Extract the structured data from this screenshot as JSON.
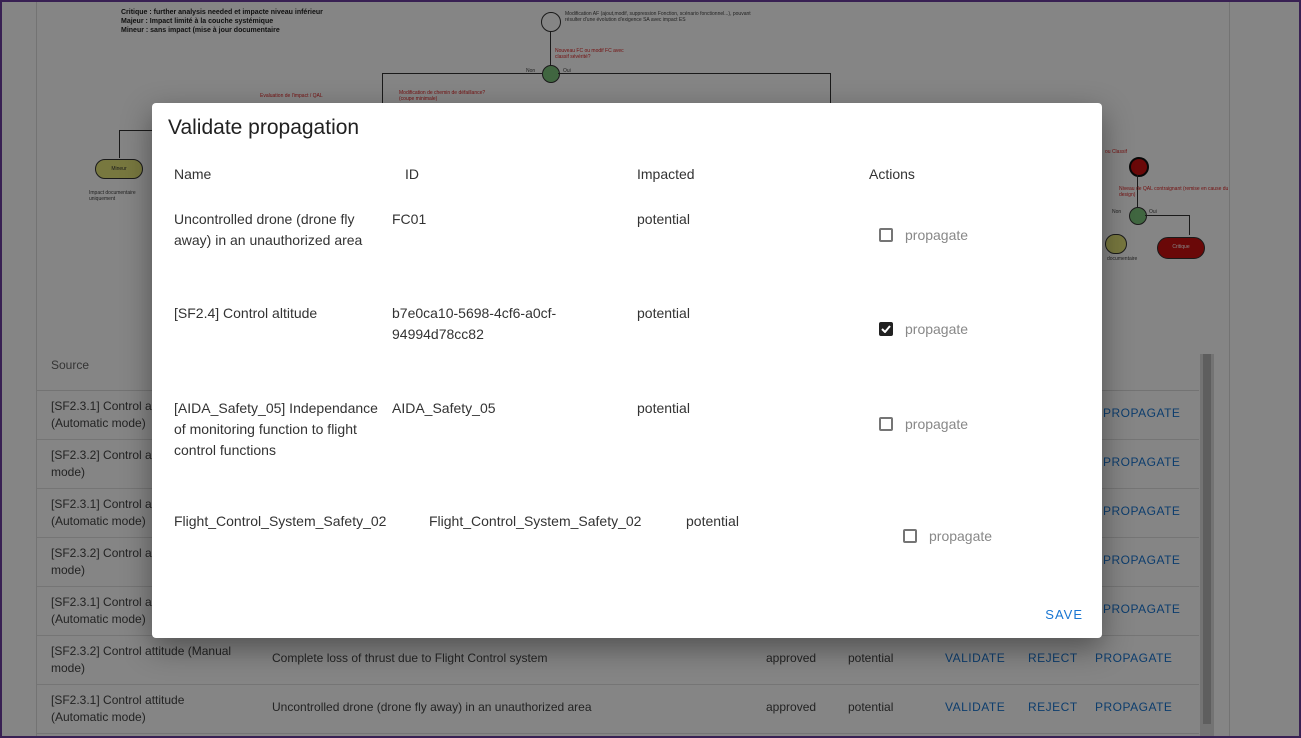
{
  "diagram": {
    "legend": [
      "Critique : further analysis needed et impacte niveau inférieur",
      "Majeur : Impact limité à la couche systémique",
      "Mineur : sans impact (mise à jour documentaire"
    ],
    "top_note": "Modification AF (ajout,modif, suppression Fonction, scénario fonctionnel...), pouvant résulter d'une évolution d'exigence SA avec impact ES",
    "q1": "Nouveau FC ou modif FC avec classif sévérité?",
    "non": "Non",
    "oui": "Oui",
    "eval": "Evaluation de l'impact / QAL",
    "modif": "Modification de chemin de défaillance? (coupe minimale)",
    "mineur": "Mineur",
    "impact_doc": "Impact documentaire uniquement",
    "ou_classif": "ou Classif",
    "niveau_qal": "Niveau de QAL contraignant (remise en cause du design)",
    "non2": "Non",
    "oui2": "Oui",
    "critique": "Critique",
    "documentaire": "documentaire"
  },
  "table": {
    "source_header": "Source",
    "rows": [
      {
        "source": "[SF2.3.1] Control a\n(Automatic mode)",
        "desc": "",
        "status": "",
        "impact": "",
        "validate": "",
        "reject": "",
        "propagate": "PROPAGATE"
      },
      {
        "source": "[SF2.3.2] Control a\nmode)",
        "desc": "",
        "status": "",
        "impact": "",
        "validate": "",
        "reject": "",
        "propagate": "PROPAGATE"
      },
      {
        "source": "[SF2.3.1] Control a\n(Automatic mode)",
        "desc": "",
        "status": "",
        "impact": "",
        "validate": "",
        "reject": "",
        "propagate": "PROPAGATE"
      },
      {
        "source": "[SF2.3.2] Control a\nmode)",
        "desc": "",
        "status": "",
        "impact": "",
        "validate": "",
        "reject": "",
        "propagate": "PROPAGATE"
      },
      {
        "source": "[SF2.3.1] Control a\n(Automatic mode)",
        "desc": "",
        "status": "",
        "impact": "",
        "validate": "",
        "reject": "",
        "propagate": "PROPAGATE"
      },
      {
        "source": "[SF2.3.2] Control attitude (Manual\nmode)",
        "desc": "Complete loss of thrust due to Flight Control system",
        "status": "approved",
        "impact": "potential",
        "validate": "VALIDATE",
        "reject": "REJECT",
        "propagate": "PROPAGATE"
      },
      {
        "source": "[SF2.3.1] Control attitude\n(Automatic mode)",
        "desc": "Uncontrolled drone (drone fly away) in an unauthorized area",
        "status": "approved",
        "impact": "potential",
        "validate": "VALIDATE",
        "reject": "REJECT",
        "propagate": "PROPAGATE"
      }
    ]
  },
  "dialog": {
    "title": "Validate propagation",
    "headers": {
      "name": "Name",
      "id": "ID",
      "impacted": "Impacted",
      "actions": "Actions"
    },
    "rows": [
      {
        "name": "Uncontrolled drone (drone fly away) in an unauthorized area",
        "id": "FC01",
        "impacted": "potential",
        "checked": false,
        "label": "propagate"
      },
      {
        "name": "[SF2.4] Control altitude",
        "id": "b7e0ca10-5698-4cf6-a0cf-94994d78cc82",
        "impacted": "potential",
        "checked": true,
        "label": "propagate"
      },
      {
        "name": "[AIDA_Safety_05] Independance of monitoring function to flight control functions",
        "id": "AIDA_Safety_05",
        "impacted": "potential",
        "checked": false,
        "label": "propagate"
      },
      {
        "name": "Flight_Control_System_Safety_02",
        "id": "Flight_Control_System_Safety_02",
        "impacted": "potential",
        "checked": false,
        "label": "propagate"
      }
    ],
    "save_label": "SAVE"
  },
  "colors": {
    "accent": "#1976d2",
    "frame": "#6b3fa0",
    "mineur": "#e6e67a",
    "critique": "#cc1111",
    "decision": "#7cc47c"
  }
}
